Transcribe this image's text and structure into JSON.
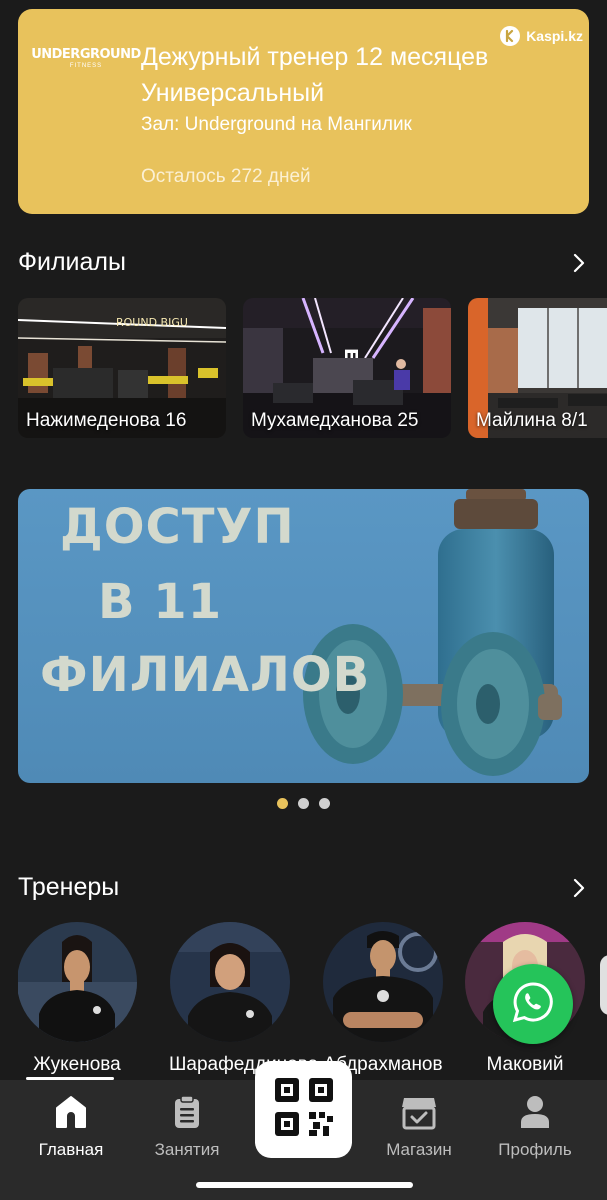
{
  "membership": {
    "logo_line1": "UNDERGROUND",
    "logo_line2": "FITNESS",
    "title": "Дежурный тренер 12 месяцев Универсальный",
    "gym": "Зал: Underground на Мангилик",
    "remaining": "Осталось 272 дней",
    "partner": "Kaspi.kz",
    "card_color": "#e8c25c"
  },
  "branches": {
    "heading": "Филиалы",
    "items": [
      {
        "label": "Нажимеденова 16"
      },
      {
        "label": "Мухамедханова 25"
      },
      {
        "label": "Майлина 8/1"
      }
    ]
  },
  "banner": {
    "line1": "ДОСТУП",
    "line2": "В 11",
    "line3": "ФИЛИАЛОВ",
    "pages": 3,
    "active_page": 1
  },
  "trainers": {
    "heading": "Тренеры",
    "items": [
      {
        "name": "Жукенова"
      },
      {
        "name": "Шарафеддинова"
      },
      {
        "name": "Абдрахманов"
      },
      {
        "name": "Маковий"
      }
    ]
  },
  "whatsapp": {
    "icon": "whatsapp-icon",
    "color": "#25c45a"
  },
  "nav": {
    "items": [
      {
        "label": "Главная",
        "icon": "home-icon"
      },
      {
        "label": "Занятия",
        "icon": "clipboard-icon"
      },
      {
        "label": "Магазин",
        "icon": "store-icon"
      },
      {
        "label": "Профиль",
        "icon": "profile-icon"
      }
    ],
    "active": "Главная",
    "center_icon": "qr-code-icon"
  },
  "colors": {
    "accent": "#e8c25c",
    "background": "#1b1b1b",
    "nav": "#2a2a2a"
  }
}
